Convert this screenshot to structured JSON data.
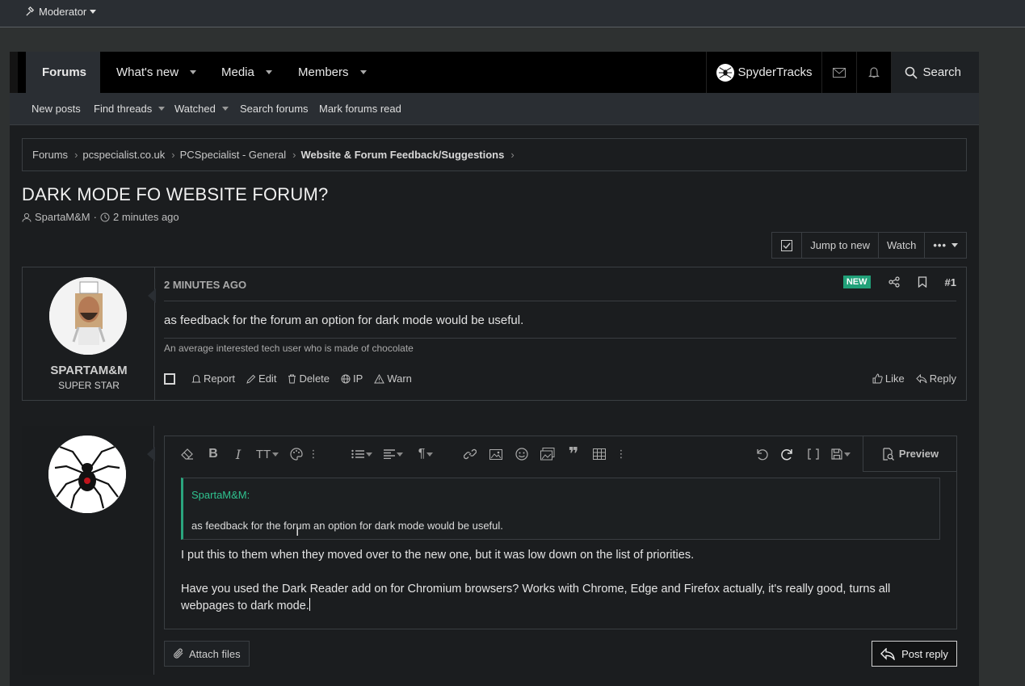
{
  "topbar": {
    "moderator_label": "Moderator"
  },
  "nav": {
    "tabs": [
      {
        "label": "Forums",
        "active": true
      },
      {
        "label": "What's new"
      },
      {
        "label": "Media"
      },
      {
        "label": "Members"
      }
    ],
    "user_name": "SpyderTracks",
    "search_label": "Search"
  },
  "subnav": {
    "items": [
      "New posts",
      "Find threads",
      "Watched",
      "Search forums",
      "Mark forums read"
    ]
  },
  "breadcrumb": [
    "Forums",
    "pcspecialist.co.uk",
    "PCSpecialist - General",
    "Website & Forum Feedback/Suggestions"
  ],
  "thread": {
    "title": "DARK MODE FO WEBSITE FORUM?",
    "author": "SpartaM&M",
    "time": "2 minutes ago",
    "actions": {
      "jump": "Jump to new",
      "watch": "Watch"
    }
  },
  "post": {
    "username": "SPARTAM&M",
    "user_title": "SUPER STAR",
    "date": "2 MINUTES AGO",
    "badge": "NEW",
    "number": "#1",
    "body": "as feedback for the forum an option for dark mode would be useful.",
    "signature": "An average interested tech user who is made of chocolate",
    "actions": [
      "Report",
      "Edit",
      "Delete",
      "IP",
      "Warn"
    ],
    "actions_right": [
      "Like",
      "Reply"
    ]
  },
  "editor": {
    "preview_label": "Preview",
    "quote_author": "SpartaM&M:",
    "quote_text": "as feedback for the forum an option for dark mode would be useful.",
    "para1": "I put this to them when they moved over to the new one, but it was low down on the list of priorities.",
    "para2": "Have you used the Dark Reader add on for Chromium browsers? Works with Chrome, Edge and Firefox actually, it's really good, turns all webpages to dark mode."
  },
  "reply": {
    "attach_label": "Attach files",
    "post_label": "Post reply"
  },
  "colors": {
    "accent_green": "#21a179",
    "nav_bg": "#000000",
    "page_bg": "#1b1d1f"
  }
}
